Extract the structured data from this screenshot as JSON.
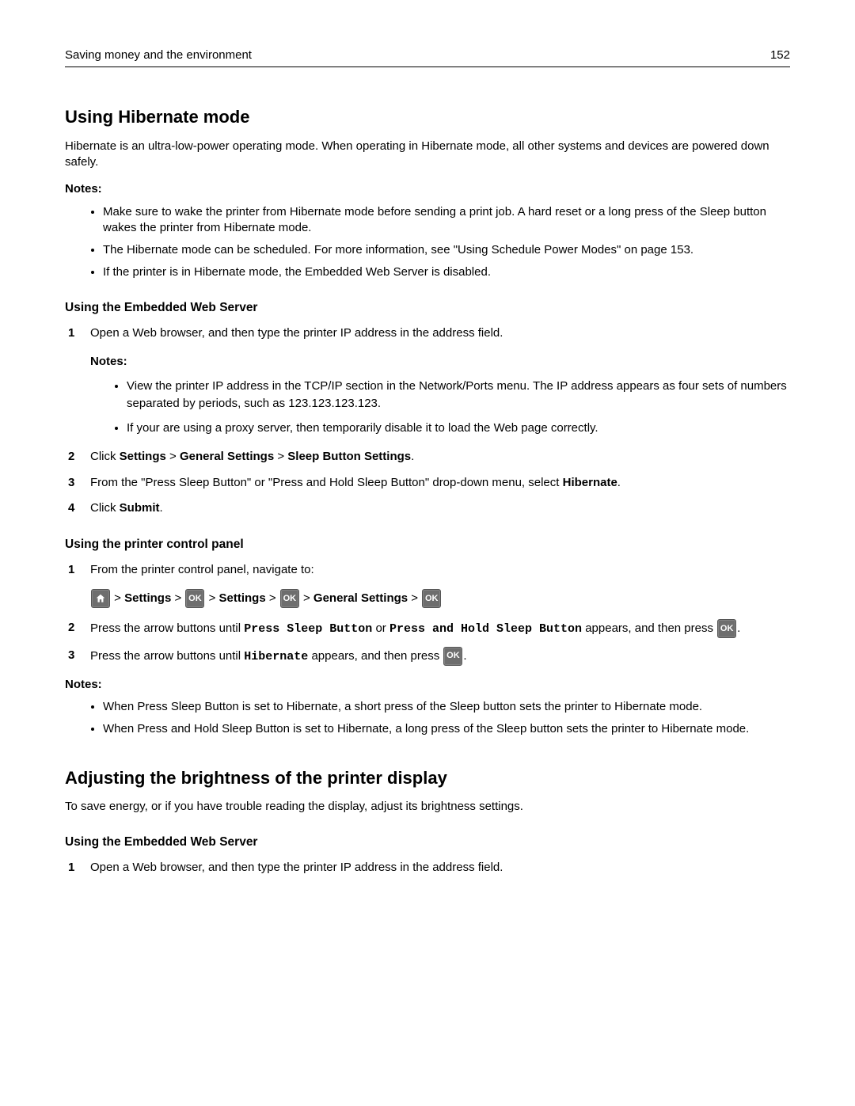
{
  "header": {
    "title": "Saving money and the environment",
    "page": "152"
  },
  "h1a": "Using Hibernate mode",
  "intro": "Hibernate is an ultra‑low‑power operating mode. When operating in Hibernate mode, all other systems and devices are powered down safely.",
  "notesLabel": "Notes:",
  "notes1": {
    "a": "Make sure to wake the printer from Hibernate mode before sending a print job. A hard reset or a long press of the Sleep button wakes the printer from Hibernate mode.",
    "b": "The Hibernate mode can be scheduled. For more information, see \"Using Schedule Power Modes\" on page 153.",
    "c": "If the printer is in Hibernate mode, the Embedded Web Server is disabled."
  },
  "h2a": "Using the Embedded Web Server",
  "stepsA": {
    "s1": "Open a Web browser, and then type the printer IP address in the address field.",
    "s1notes": {
      "a": "View the printer IP address in the TCP/IP section in the Network/Ports menu. The IP address appears as four sets of numbers separated by periods, such as 123.123.123.123.",
      "b": "If your are using a proxy server, then temporarily disable it to load the Web page correctly."
    },
    "s2_pre": "Click ",
    "s2_b1": "Settings",
    "s2_sep": " > ",
    "s2_b2": "General Settings",
    "s2_b3": "Sleep Button Settings",
    "s3_pre": "From the \"Press Sleep Button\" or \"Press and Hold Sleep Button\" drop‑down menu, select ",
    "s3_b": "Hibernate",
    "s4_pre": "Click ",
    "s4_b": "Submit"
  },
  "h2b": "Using the printer control panel",
  "stepsB": {
    "s1": "From the printer control panel, navigate to:",
    "nav_sep": " > ",
    "nav_settings": "Settings",
    "nav_general": "General Settings",
    "s2_pre": "Press the arrow buttons until ",
    "s2_m1": "Press Sleep Button",
    "s2_or": " or ",
    "s2_m2": "Press and Hold Sleep Button",
    "s2_post": " appears, and then press ",
    "s3_pre": "Press the arrow buttons until ",
    "s3_m": "Hibernate",
    "s3_post": " appears, and then press "
  },
  "notes2": {
    "a": "When Press Sleep Button is set to Hibernate, a short press of the Sleep button sets the printer to Hibernate mode.",
    "b": "When Press and Hold Sleep Button is set to Hibernate, a long press of the Sleep button sets the printer to Hibernate mode."
  },
  "h1b": "Adjusting the brightness of the printer display",
  "brightIntro": "To save energy, or if you have trouble reading the display, adjust its brightness settings.",
  "h2c": "Using the Embedded Web Server",
  "stepsC": {
    "s1": "Open a Web browser, and then type the printer IP address in the address field."
  },
  "icons": {
    "ok": "OK"
  },
  "period": "."
}
